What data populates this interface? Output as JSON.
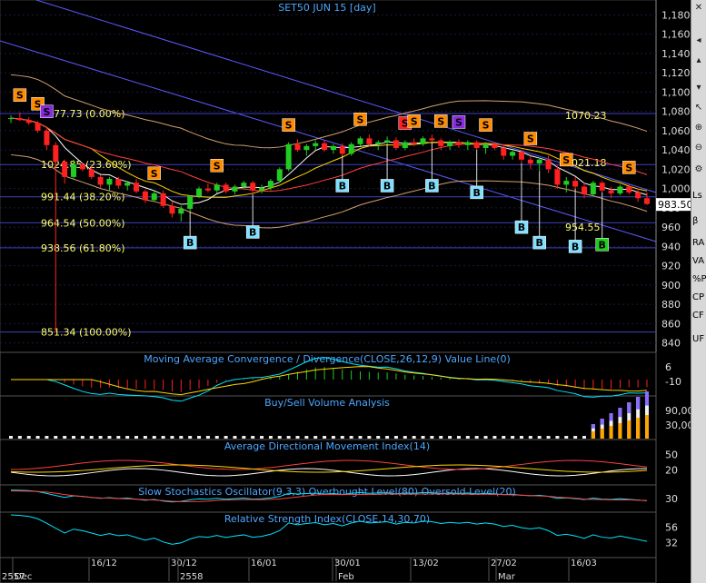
{
  "chart_data": {
    "type": "candlestick",
    "title": "SET50 JUN 15",
    "interval": "[day]",
    "price_axis": {
      "ticks": [
        "1,180",
        "1,160",
        "1,140",
        "1,120",
        "1,100",
        "1,080",
        "1,060",
        "1,040",
        "1,020",
        "1,000",
        "980",
        "960",
        "940",
        "920",
        "900",
        "880",
        "860",
        "840"
      ],
      "ylim": [
        834,
        1186
      ],
      "last_price": "983.50"
    },
    "x_ticks": [
      "Dec",
      "16/12",
      "30/12",
      "2558",
      "16/01",
      "Feb",
      "30/01",
      "13/02",
      "27/02",
      "Mar",
      "16/03"
    ],
    "x_top_label": "2557",
    "bars": [
      [
        1072,
        1076,
        1068,
        1073
      ],
      [
        1073,
        1079,
        1070,
        1071
      ],
      [
        1071,
        1074,
        1066,
        1068
      ],
      [
        1068,
        1070,
        1058,
        1060
      ],
      [
        1060,
        1062,
        1040,
        1045
      ],
      [
        1045,
        1048,
        851,
        1028
      ],
      [
        1028,
        1030,
        1005,
        1012
      ],
      [
        1012,
        1030,
        1010,
        1025
      ],
      [
        1025,
        1027,
        1018,
        1020
      ],
      [
        1020,
        1023,
        1010,
        1012
      ],
      [
        1012,
        1014,
        1000,
        1004
      ],
      [
        1004,
        1012,
        998,
        1010
      ],
      [
        1010,
        1012,
        1000,
        1003
      ],
      [
        1003,
        1008,
        998,
        1006
      ],
      [
        1006,
        1010,
        995,
        997
      ],
      [
        997,
        999,
        985,
        988
      ],
      [
        988,
        998,
        986,
        995
      ],
      [
        995,
        998,
        980,
        982
      ],
      [
        982,
        987,
        970,
        974
      ],
      [
        974,
        982,
        966,
        979
      ],
      [
        979,
        993,
        976,
        992
      ],
      [
        992,
        1002,
        990,
        1000
      ],
      [
        1000,
        1005,
        996,
        998
      ],
      [
        998,
        1006,
        995,
        1004
      ],
      [
        1004,
        1006,
        995,
        997
      ],
      [
        997,
        1004,
        994,
        1002
      ],
      [
        1002,
        1008,
        999,
        1006
      ],
      [
        1006,
        1008,
        994,
        998
      ],
      [
        998,
        1004,
        995,
        1001
      ],
      [
        1001,
        1010,
        998,
        1008
      ],
      [
        1008,
        1022,
        1006,
        1020
      ],
      [
        1020,
        1048,
        1018,
        1046
      ],
      [
        1046,
        1051,
        1038,
        1040
      ],
      [
        1040,
        1046,
        1034,
        1044
      ],
      [
        1044,
        1050,
        1040,
        1047
      ],
      [
        1047,
        1050,
        1038,
        1040
      ],
      [
        1040,
        1046,
        1036,
        1044
      ],
      [
        1044,
        1047,
        1034,
        1036
      ],
      [
        1036,
        1048,
        1034,
        1046
      ],
      [
        1046,
        1054,
        1044,
        1052
      ],
      [
        1052,
        1056,
        1044,
        1046
      ],
      [
        1046,
        1050,
        1040,
        1048
      ],
      [
        1048,
        1054,
        1046,
        1050
      ],
      [
        1050,
        1053,
        1040,
        1042
      ],
      [
        1042,
        1050,
        1040,
        1048
      ],
      [
        1048,
        1052,
        1044,
        1046
      ],
      [
        1046,
        1054,
        1044,
        1052
      ],
      [
        1052,
        1056,
        1048,
        1050
      ],
      [
        1050,
        1052,
        1040,
        1044
      ],
      [
        1044,
        1050,
        1040,
        1048
      ],
      [
        1048,
        1051,
        1042,
        1045
      ],
      [
        1045,
        1050,
        1040,
        1048
      ],
      [
        1048,
        1050,
        1040,
        1042
      ],
      [
        1042,
        1048,
        1036,
        1046
      ],
      [
        1046,
        1048,
        1040,
        1042
      ],
      [
        1042,
        1046,
        1030,
        1034
      ],
      [
        1034,
        1040,
        1030,
        1038
      ],
      [
        1038,
        1040,
        1026,
        1030
      ],
      [
        1030,
        1034,
        1020,
        1026
      ],
      [
        1026,
        1032,
        1018,
        1030
      ],
      [
        1030,
        1034,
        1016,
        1020
      ],
      [
        1020,
        1024,
        1000,
        1004
      ],
      [
        1004,
        1012,
        996,
        1008
      ],
      [
        1008,
        1012,
        1000,
        1002
      ],
      [
        1002,
        1006,
        990,
        994
      ],
      [
        994,
        1008,
        992,
        1006
      ],
      [
        1006,
        1008,
        996,
        998
      ],
      [
        998,
        1002,
        990,
        995
      ],
      [
        995,
        1004,
        993,
        1002
      ],
      [
        1002,
        1004,
        994,
        996
      ],
      [
        996,
        1000,
        986,
        990
      ],
      [
        990,
        996,
        983,
        984
      ]
    ],
    "fib_levels": [
      {
        "label": "1077.73 (0.00%)",
        "value": 1077.73
      },
      {
        "label": "1024.85 (23.60%)",
        "value": 1024.85
      },
      {
        "label": "991.44 (38.20%)",
        "value": 991.44
      },
      {
        "label": "964.54 (50.00%)",
        "value": 964.54
      },
      {
        "label": "938.56 (61.80%)",
        "value": 938.56
      },
      {
        "label": "851.34 (100.00%)",
        "value": 851.34
      }
    ],
    "annotations": [
      {
        "label": "1070.23",
        "value": 1070.23
      },
      {
        "label": "1021.18",
        "value": 1021.18
      },
      {
        "label": "954.55",
        "value": 954.55
      }
    ],
    "sell_signals": [
      {
        "bar": 1,
        "color": "#ff8c00"
      },
      {
        "bar": 3,
        "color": "#ff8c00"
      },
      {
        "bar": 4,
        "color": "#8a2be2"
      },
      {
        "bar": 16,
        "color": "#ff8c00"
      },
      {
        "bar": 23,
        "color": "#ff8c00"
      },
      {
        "bar": 31,
        "color": "#ff8c00"
      },
      {
        "bar": 39,
        "color": "#ff8c00"
      },
      {
        "bar": 44,
        "color": "#ff2020"
      },
      {
        "bar": 45,
        "color": "#ff8c00"
      },
      {
        "bar": 48,
        "color": "#ff8c00"
      },
      {
        "bar": 50,
        "color": "#8a2be2"
      },
      {
        "bar": 53,
        "color": "#ff8c00"
      },
      {
        "bar": 58,
        "color": "#ff8c00"
      },
      {
        "bar": 62,
        "color": "#ff8c00"
      },
      {
        "bar": 69,
        "color": "#ff8c00"
      }
    ],
    "buy_signals": [
      {
        "bar": 20,
        "value": 944
      },
      {
        "bar": 27,
        "value": 955
      },
      {
        "bar": 37,
        "value": 1003
      },
      {
        "bar": 42,
        "value": 1003
      },
      {
        "bar": 47,
        "value": 1003
      },
      {
        "bar": 52,
        "value": 996
      },
      {
        "bar": 57,
        "value": 960
      },
      {
        "bar": 59,
        "value": 944
      },
      {
        "bar": 63,
        "value": 940
      },
      {
        "bar": 66,
        "value": 942,
        "color": "#22cc22"
      }
    ],
    "panels": [
      {
        "title": "Moving Average Convergence / Divergence(CLOSE,26,12,9) Value Line(0)",
        "ticks": [
          "6",
          "-10"
        ]
      },
      {
        "title": "Buy/Sell Volume Analysis",
        "ticks": [
          "90,00",
          "30,00"
        ]
      },
      {
        "title": "Average Directional Movement Index(14)",
        "ticks": [
          "50",
          "20"
        ]
      },
      {
        "title": "Slow Stochastics Oscillator(9,3,3) Overbought Level(80) Oversold Level(20)",
        "ticks": [
          "30"
        ]
      },
      {
        "title": "Relative Strength Index(CLOSE,14,30,70)",
        "ticks": [
          "56",
          "32"
        ]
      }
    ],
    "colors": {
      "up": "#22cc22",
      "down": "#ff2020",
      "sell_signal": "#ff8c00",
      "buy_signal": "#80e0ff",
      "title": "#4da6ff"
    }
  },
  "sidebar": {
    "labels": [
      "Ls",
      "β",
      "RA",
      "VA",
      "%P",
      "CP",
      "CF",
      "UF"
    ]
  }
}
